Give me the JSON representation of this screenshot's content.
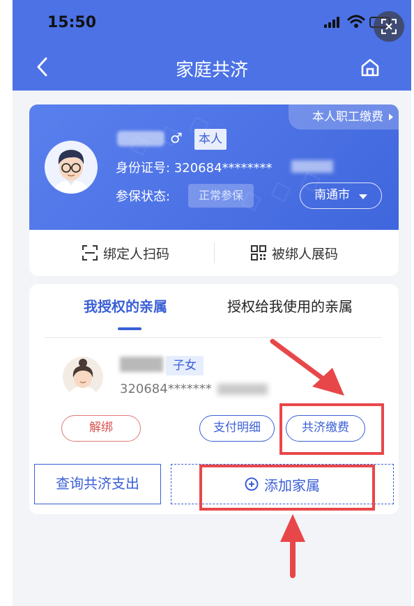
{
  "status_bar": {
    "time": "15:50"
  },
  "nav": {
    "title": "家庭共济"
  },
  "profile": {
    "tag": "本人职工缴费",
    "gender_symbol": "♂",
    "self_badge": "本人",
    "id_label": "身份证号:",
    "id_value": "320684********",
    "status_label": "参保状态:",
    "status_value": "正常参保",
    "city": "南通市"
  },
  "qr_actions": {
    "bind_scan": "绑定人扫码",
    "show_code": "被绑人展码"
  },
  "tabs": {
    "authorized": "我授权的亲属",
    "authorized_to_me": "授权给我使用的亲属"
  },
  "member": {
    "relation": "子女",
    "id_value": "320684*******"
  },
  "member_actions": {
    "unbind": "解绑",
    "pay_detail": "支付明细",
    "joint_pay": "共济缴费"
  },
  "bottom_actions": {
    "query": "查询共济支出",
    "add_family": "添加家属"
  },
  "colors": {
    "primary": "#3a5fd6",
    "header": "#4c72e6",
    "danger": "#d9534f",
    "annotation": "#e8474a"
  }
}
